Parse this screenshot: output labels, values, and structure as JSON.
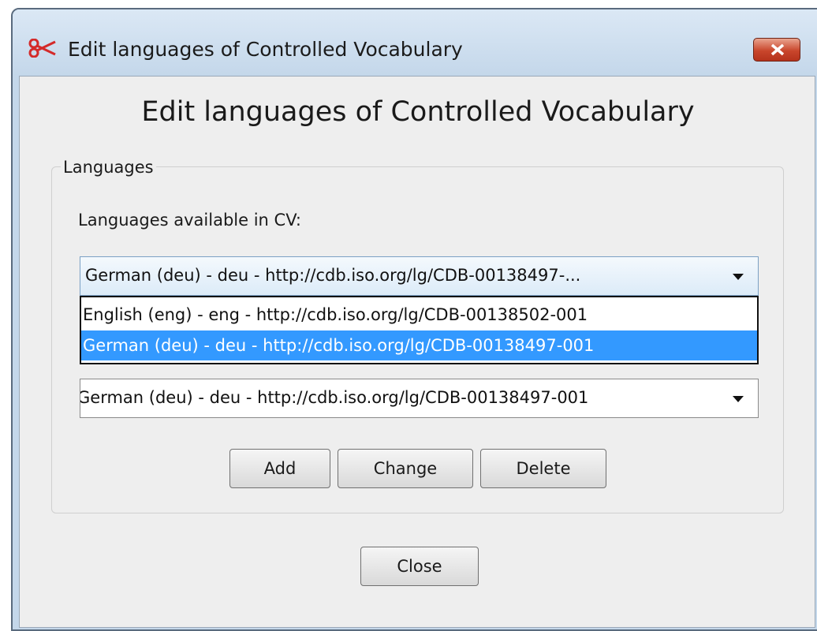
{
  "window": {
    "title": "Edit languages of Controlled Vocabulary",
    "app_icon": "scissors-app-icon",
    "close_icon": "close-icon"
  },
  "dialog": {
    "heading": "Edit languages of Controlled Vocabulary",
    "group_label": "Languages",
    "available_label": "Languages available in CV:",
    "cv_combo": {
      "selected": "German (deu) - deu - http://cdb.iso.org/lg/CDB-00138497-..."
    },
    "cv_options": [
      {
        "label": "English (eng) - eng - http://cdb.iso.org/lg/CDB-00138502-001",
        "selected": false
      },
      {
        "label": "German (deu) - deu - http://cdb.iso.org/lg/CDB-00138497-001",
        "selected": true
      }
    ],
    "language_combo": {
      "selected": "German (deu) - deu - http://cdb.iso.org/lg/CDB-00138497-001"
    },
    "buttons": {
      "add": "Add",
      "change": "Change",
      "delete": "Delete",
      "close": "Close"
    }
  },
  "colors": {
    "titlebar": "#c4d7ea",
    "dialog_bg": "#eeeeee",
    "selection": "#3399ff",
    "close_button": "#c9462c"
  }
}
